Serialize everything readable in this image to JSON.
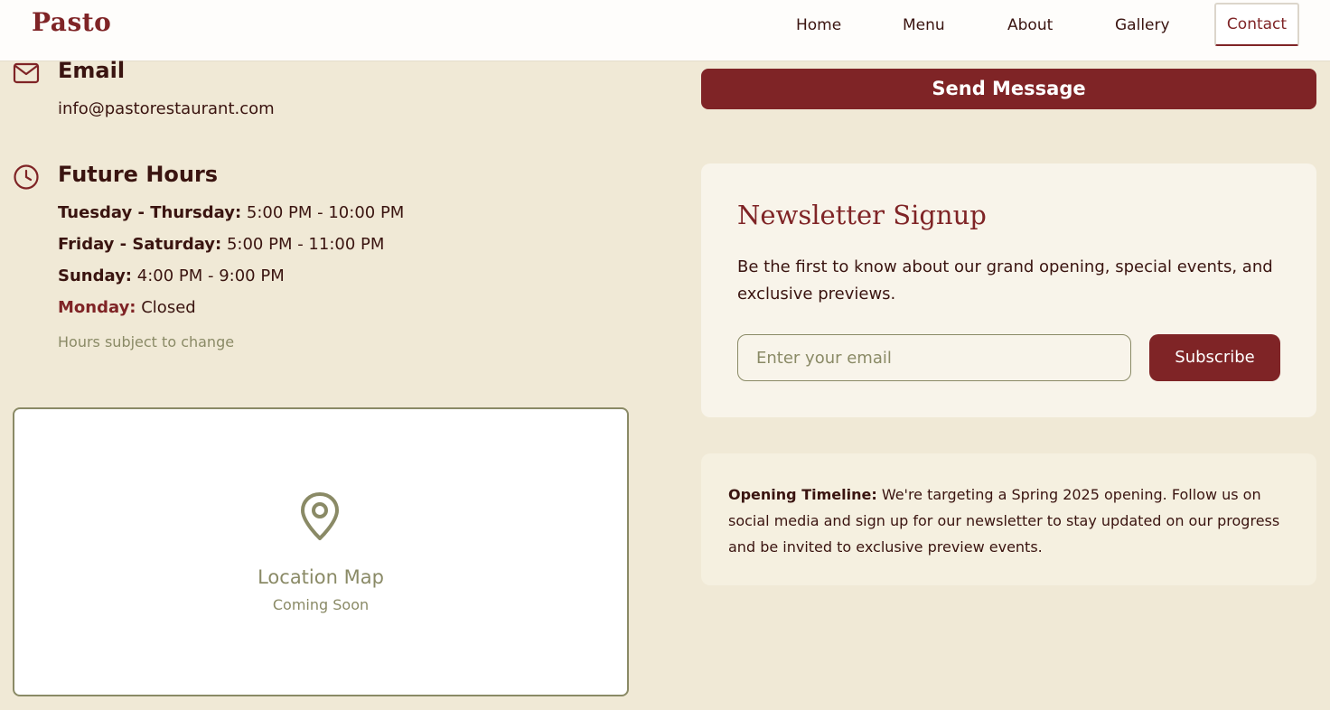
{
  "brand": {
    "logo": "Pasto"
  },
  "nav": {
    "items": [
      {
        "label": "Home"
      },
      {
        "label": "Menu"
      },
      {
        "label": "About"
      },
      {
        "label": "Gallery"
      },
      {
        "label": "Contact"
      }
    ],
    "active": "Contact"
  },
  "email": {
    "heading": "Email",
    "value": "info@pastorestaurant.com"
  },
  "hours": {
    "heading": "Future Hours",
    "rows": [
      {
        "days": "Tuesday - Thursday:",
        "time": " 5:00 PM - 10:00 PM"
      },
      {
        "days": "Friday - Saturday:",
        "time": " 5:00 PM - 11:00 PM"
      },
      {
        "days": "Sunday:",
        "time": " 4:00 PM - 9:00 PM"
      },
      {
        "days": "Monday:",
        "time": " Closed"
      }
    ],
    "note": "Hours subject to change"
  },
  "map": {
    "title": "Location Map",
    "subtitle": "Coming Soon"
  },
  "form": {
    "submit_label": "Send Message"
  },
  "newsletter": {
    "title": "Newsletter Signup",
    "description": "Be the first to know about our grand opening, special events, and exclusive previews.",
    "placeholder": "Enter your email",
    "button_label": "Subscribe"
  },
  "timeline": {
    "label": "Opening Timeline:",
    "text": " We're targeting a Spring 2025 opening. Follow us on social media and sign up for our newsletter to stay updated on our progress and be invited to exclusive preview events."
  },
  "colors": {
    "brand": "#7f2426",
    "background": "#f0e9d6",
    "muted": "#8a8a66",
    "text": "#3a1410"
  }
}
